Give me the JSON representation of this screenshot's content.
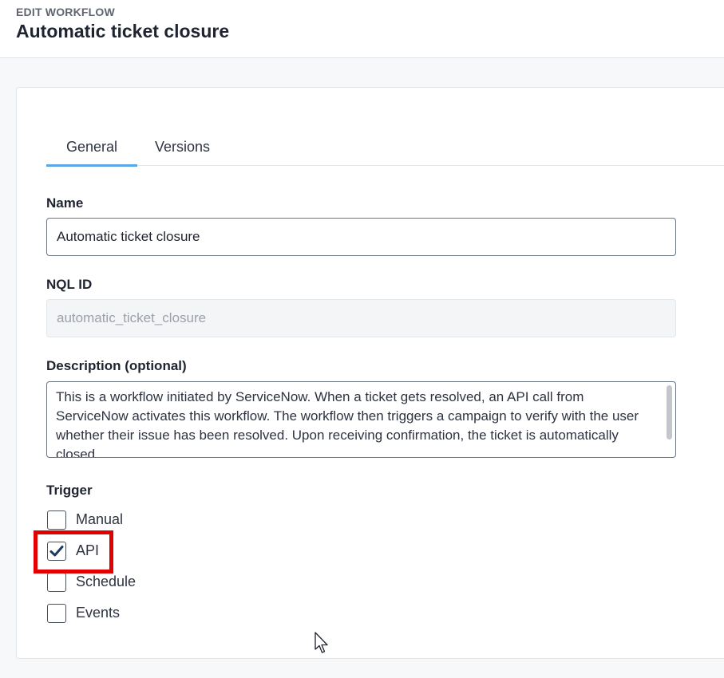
{
  "header": {
    "kicker": "EDIT WORKFLOW",
    "title": "Automatic ticket closure"
  },
  "tabs": [
    {
      "label": "General",
      "active": true
    },
    {
      "label": "Versions",
      "active": false
    }
  ],
  "form": {
    "name": {
      "label": "Name",
      "value": "Automatic ticket closure"
    },
    "nql_id": {
      "label": "NQL ID",
      "value": "automatic_ticket_closure"
    },
    "description": {
      "label": "Description (optional)",
      "value": "This is a workflow initiated by ServiceNow. When a ticket gets resolved, an API call from ServiceNow activates this workflow. The workflow then triggers a campaign to verify with the user whether their issue has been resolved. Upon receiving confirmation, the ticket is automatically closed."
    },
    "trigger": {
      "label": "Trigger",
      "options": [
        {
          "label": "Manual",
          "checked": false
        },
        {
          "label": "API",
          "checked": true
        },
        {
          "label": "Schedule",
          "checked": false
        },
        {
          "label": "Events",
          "checked": false
        }
      ]
    }
  },
  "colors": {
    "tab_underline": "#5aa6e6",
    "highlight": "#e00000",
    "check": "#1f3b5c"
  },
  "icons": {
    "check": "checkmark-icon",
    "cursor": "mouse-pointer-icon"
  }
}
